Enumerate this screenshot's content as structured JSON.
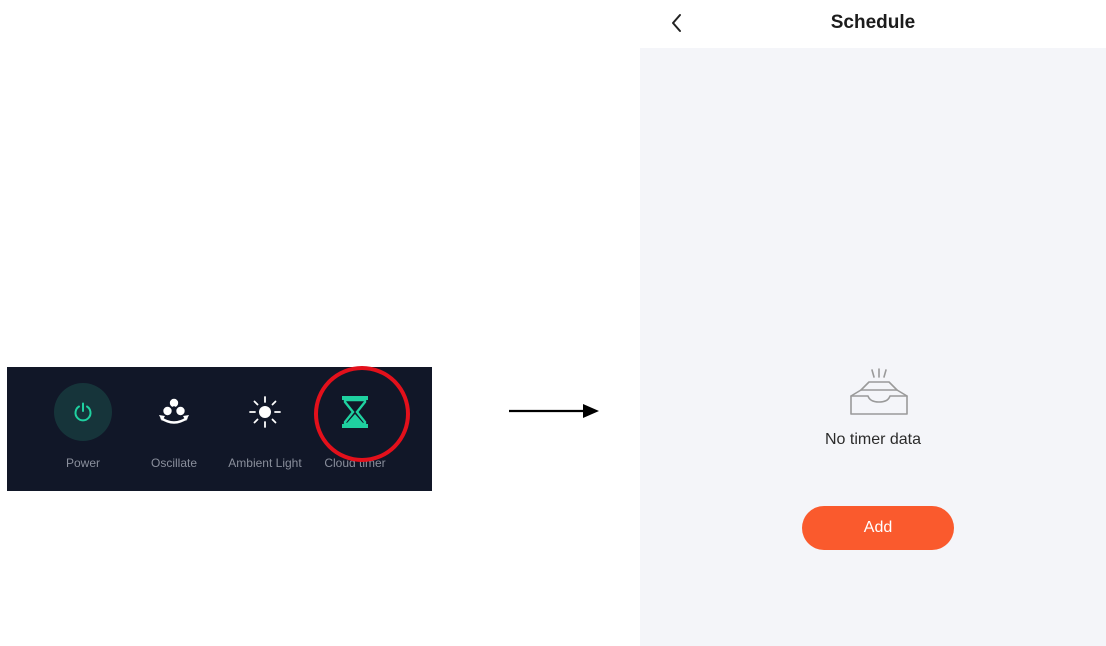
{
  "control_bar": {
    "items": [
      {
        "label": "Power",
        "icon": "power-icon"
      },
      {
        "label": "Oscillate",
        "icon": "fan-oscillate-icon"
      },
      {
        "label": "Ambient Light",
        "icon": "sun-icon"
      },
      {
        "label": "Cloud timer",
        "icon": "hourglass-icon"
      }
    ],
    "highlighted": "Cloud timer",
    "colors": {
      "background": "#111728",
      "accent": "#1fd1a0",
      "highlight": "#e3101b"
    }
  },
  "schedule_screen": {
    "title": "Schedule",
    "back_icon": "chevron-left-icon",
    "empty_icon": "empty-inbox-icon",
    "empty_text": "No timer data",
    "add_label": "Add",
    "colors": {
      "background": "#f4f5f9",
      "button": "#fa5a2d"
    }
  }
}
